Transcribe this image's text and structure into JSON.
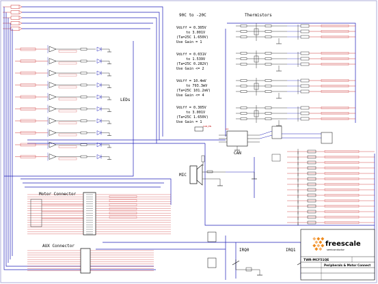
{
  "sections": {
    "temperature_range": "90C to -20C",
    "thermistors": "Thermistors",
    "leds": "LEDs",
    "can": "CAN",
    "mic": "MIC",
    "motor_connector": "Motor Connector",
    "aux_connector": "AUX Connector",
    "irq0": "IRQ0",
    "irq1": "IRQ1"
  },
  "gain_notes": [
    [
      "Vdiff = 0.305V",
      "to 3.001V",
      "(Ta=25C 1.650V)",
      "Use Gain = 1"
    ],
    [
      "Vdiff = 0.031V",
      "to 1.539V",
      "(Ta=25C 0.282V)",
      "Use Gain <= 2"
    ],
    [
      "Vdiff = 10.4mV",
      "to 793.3mV",
      "(Ta=25C 101.2mV)",
      "Use Gain <= 4"
    ],
    [
      "Vdiff = 0.305V",
      "to 3.001V",
      "(Ta=25C 1.650V)",
      "Use Gain = 1"
    ]
  ],
  "title_block": {
    "logo": "freescale",
    "logo_tagline": "semiconductor",
    "board": "TWR-MCF51QE",
    "page_title": "Peripherals & Motor Connect"
  },
  "colors": {
    "wire": "#1c1cb8",
    "net_label": "#c00000",
    "component": "#000000",
    "logo_orange": "#f08a1c"
  }
}
